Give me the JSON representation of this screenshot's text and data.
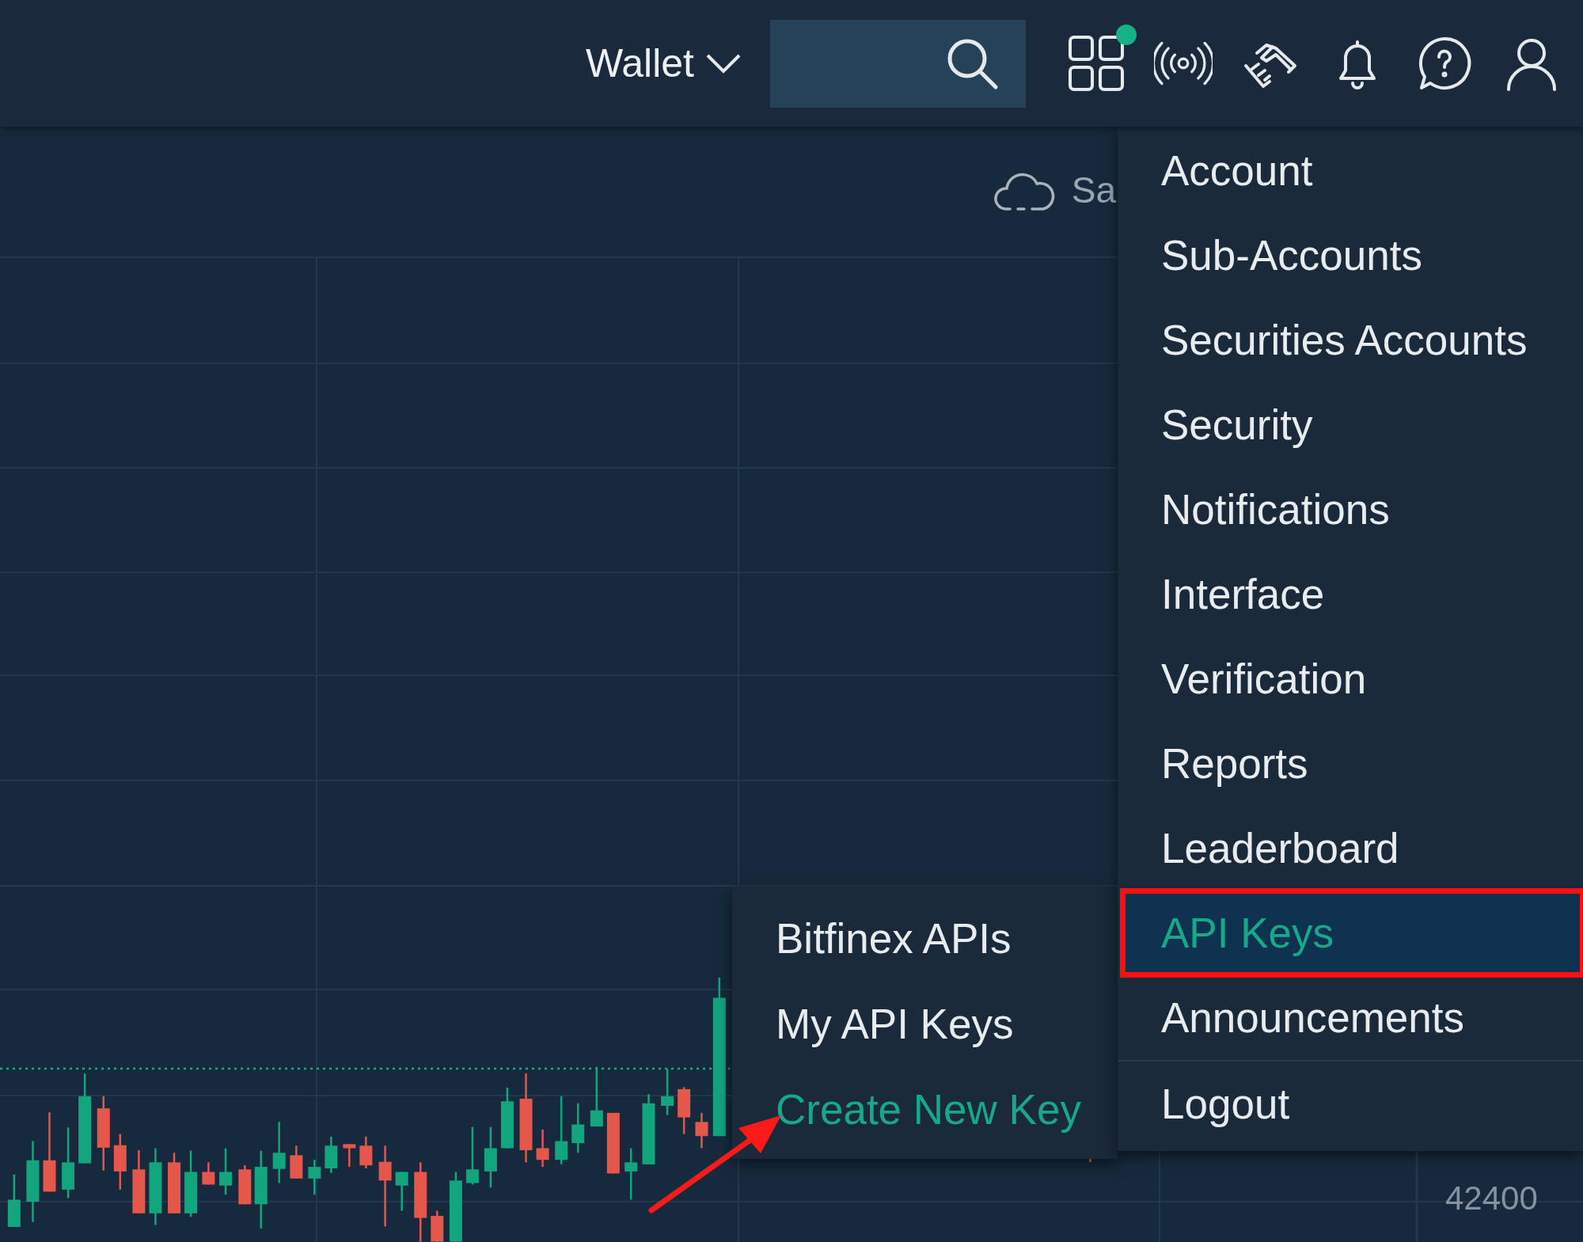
{
  "top_bar": {
    "wallet": {
      "label": "Wallet"
    },
    "icons": [
      {
        "kind": "apps",
        "badge": true
      },
      {
        "kind": "broadcast",
        "badge": false
      },
      {
        "kind": "handshake",
        "badge": false
      },
      {
        "kind": "bell",
        "badge": false
      },
      {
        "kind": "help",
        "badge": false
      },
      {
        "kind": "user",
        "badge": false
      }
    ]
  },
  "chart": {
    "save_label": "Sa",
    "price_label": "42400",
    "annotation_arrow": true
  },
  "submenu": {
    "items": [
      {
        "label": "Bitfinex APIs",
        "selected": false
      },
      {
        "label": "My API Keys",
        "selected": false
      },
      {
        "label": "Create New Key",
        "selected": true
      }
    ]
  },
  "account_menu": {
    "items": [
      {
        "label": "Account",
        "selected": false,
        "highlighted": false,
        "divider_before": false
      },
      {
        "label": "Sub-Accounts",
        "selected": false,
        "highlighted": false,
        "divider_before": false
      },
      {
        "label": "Securities Accounts",
        "selected": false,
        "highlighted": false,
        "divider_before": false
      },
      {
        "label": "Security",
        "selected": false,
        "highlighted": false,
        "divider_before": false
      },
      {
        "label": "Notifications",
        "selected": false,
        "highlighted": false,
        "divider_before": false
      },
      {
        "label": "Interface",
        "selected": false,
        "highlighted": false,
        "divider_before": false
      },
      {
        "label": "Verification",
        "selected": false,
        "highlighted": false,
        "divider_before": false
      },
      {
        "label": "Reports",
        "selected": false,
        "highlighted": false,
        "divider_before": false
      },
      {
        "label": "Leaderboard",
        "selected": false,
        "highlighted": false,
        "divider_before": false
      },
      {
        "label": "API Keys",
        "selected": true,
        "highlighted": true,
        "divider_before": false
      },
      {
        "label": "Announcements",
        "selected": false,
        "highlighted": false,
        "divider_before": false
      },
      {
        "label": "Logout",
        "selected": false,
        "highlighted": false,
        "divider_before": true
      }
    ]
  }
}
